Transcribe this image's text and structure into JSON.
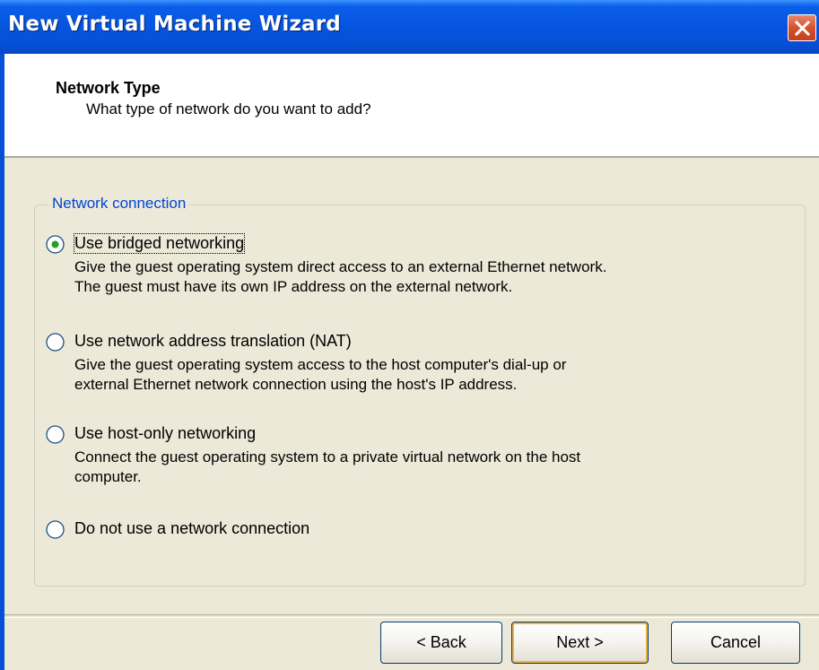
{
  "window": {
    "title": "New Virtual Machine Wizard"
  },
  "header": {
    "title": "Network Type",
    "subtitle": "What type of network do you want to add?"
  },
  "group": {
    "label": "Network connection"
  },
  "options": [
    {
      "label": "Use bridged networking",
      "selected": true,
      "desc1": "Give the guest operating system direct access to an external Ethernet network.",
      "desc2": "The guest must have its own IP address on the external network."
    },
    {
      "label": "Use network address translation (NAT)",
      "selected": false,
      "desc1": "Give the guest operating system access to the host computer's dial-up or",
      "desc2": "external Ethernet network connection using the host's IP address."
    },
    {
      "label": "Use host-only networking",
      "selected": false,
      "desc1": "Connect the guest operating system to a private virtual network on the host",
      "desc2": "computer."
    },
    {
      "label": "Do not use a network connection",
      "selected": false
    }
  ],
  "buttons": {
    "back": "< Back",
    "next": "Next >",
    "cancel": "Cancel"
  },
  "colors": {
    "titlebar": "#0550d6",
    "close": "#d7512b",
    "face": "#ece9d8",
    "legend": "#0046d5"
  }
}
